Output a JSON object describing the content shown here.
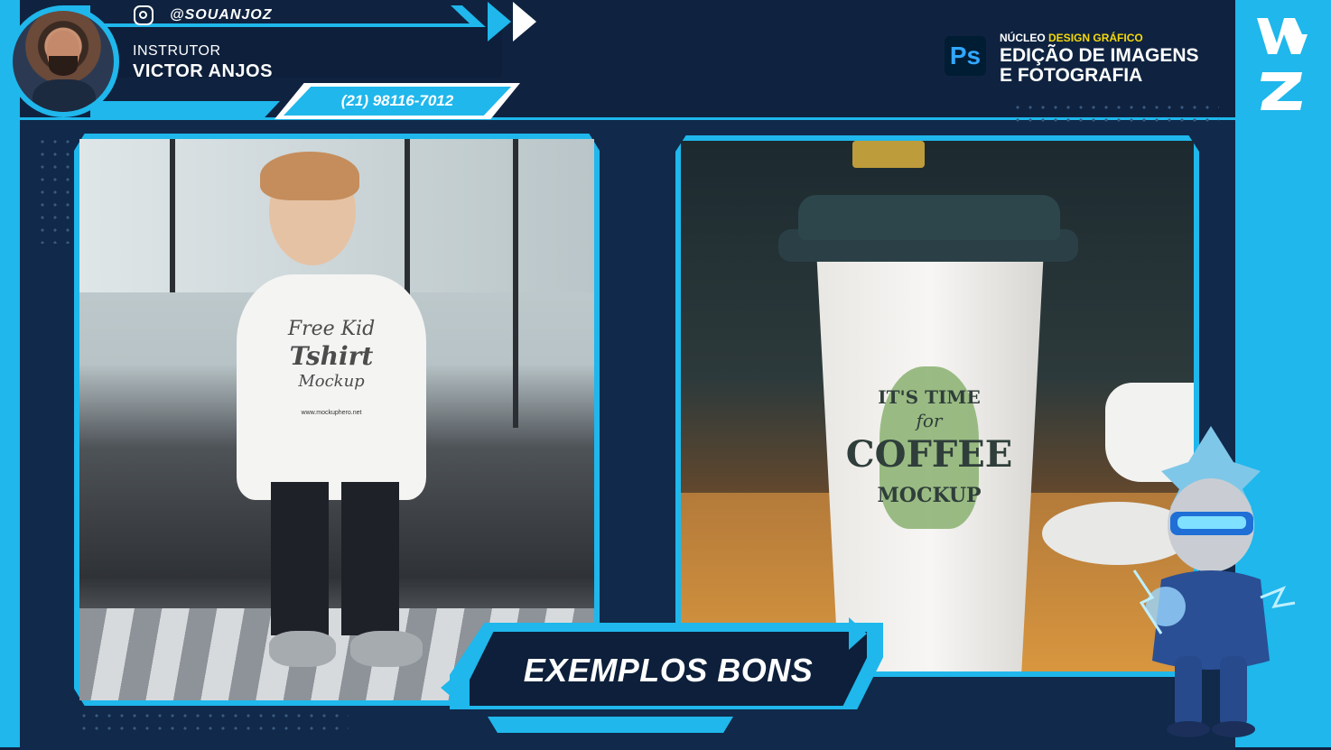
{
  "header": {
    "instagram_handle": "@SOUANJOZ",
    "instructor_label": "INSTRUTOR",
    "instructor_name": "VICTOR ANJOS",
    "phone": "(21) 98116-7012"
  },
  "course": {
    "app_icon_label": "Ps",
    "nucleo_prefix": "NÚCLEO",
    "nucleo_highlight": "DESIGN GRÁFICO",
    "title_line1": "EDIÇÃO DE IMAGENS",
    "title_line2": "E FOTOGRAFIA"
  },
  "photos": {
    "left": {
      "shirt_line1": "Free Kid",
      "shirt_line2": "Tshirt",
      "shirt_line3": "Mockup",
      "shirt_url": "www.mockuphero.net"
    },
    "right": {
      "cup_line1": "IT'S TIME",
      "cup_line2": "for",
      "cup_line3": "COFFEE",
      "cup_line4": "MOCKUP"
    }
  },
  "banner": {
    "label": "EXEMPLOS BONS"
  },
  "colors": {
    "accent": "#1fb7ec",
    "background": "#0f2340",
    "highlight": "#f5d90a"
  },
  "icons": {
    "social": "instagram-icon",
    "app": "photoshop-icon",
    "brand": "vz-logo-icon"
  }
}
